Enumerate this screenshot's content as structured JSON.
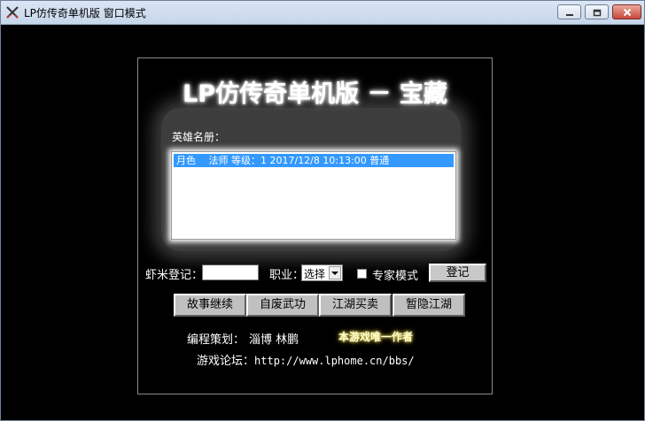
{
  "window": {
    "title": "LP仿传奇单机版 窗口模式",
    "icon": "crossed-swords-icon",
    "controls": [
      "minimize-icon",
      "maximize-icon",
      "close-icon"
    ]
  },
  "game": {
    "title": "LP仿传奇单机版 － 宝藏",
    "hero_list_label": "英雄名册：",
    "hero_entries": [
      "月色　 法师 等级：1  2017/12/8 10:13:00 普通"
    ],
    "register": {
      "name_label": "虾米登记：",
      "name_value": "",
      "class_label": "职业：",
      "class_selected": "选择",
      "expert_mode_label": "专家模式",
      "expert_mode_checked": false,
      "submit_label": "登记"
    },
    "menu_buttons": [
      "故事继续",
      "自废武功",
      "江湖买卖",
      "暂隐江湖"
    ],
    "credits": {
      "author_label": "编程策划：",
      "author_name": "淄博 林鹏",
      "tagline": "本游戏唯一作者"
    },
    "forum": {
      "label": "游戏论坛：",
      "url": "http://www.lphome.cn/bbs/"
    }
  },
  "colors": {
    "selection": "#3399ff",
    "title_bar": "#c6d6ea",
    "close_button": "#c8473a",
    "tagline_glow": "#ffef99"
  }
}
